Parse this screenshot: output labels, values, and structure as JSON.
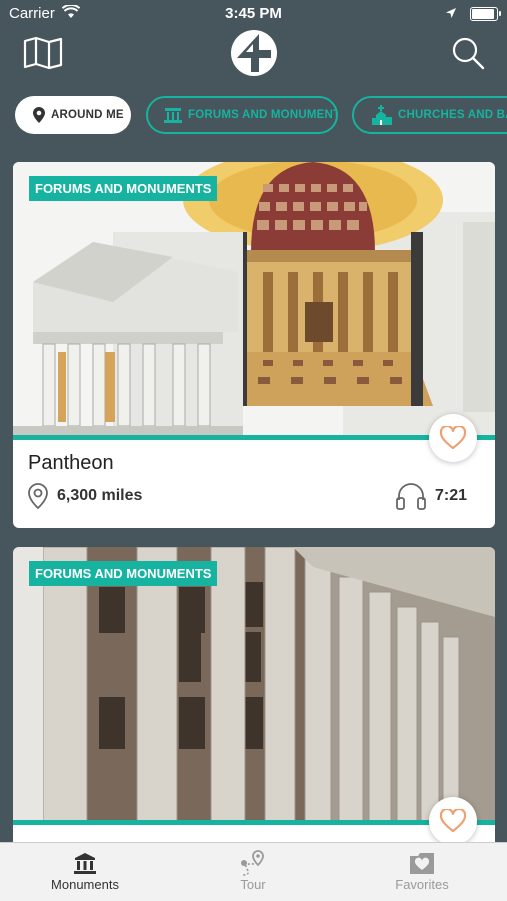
{
  "status_bar": {
    "carrier": "Carrier",
    "time": "3:45 PM",
    "battery_level": 1.0
  },
  "navbar": {
    "left_icon": "map-icon",
    "logo": "app-logo",
    "right_icon": "search-icon"
  },
  "filters": [
    {
      "label": "AROUND ME",
      "icon": "location-pin-icon",
      "active": true
    },
    {
      "label": "FORUMS AND MONUMENTS",
      "icon": "monument-icon",
      "active": false
    },
    {
      "label": "CHURCHES AND BASILIC",
      "icon": "church-icon",
      "active": false
    }
  ],
  "cards": [
    {
      "category": "FORUMS AND MONUMENTS",
      "title": "Pantheon",
      "distance": "6,300 miles",
      "duration": "7:21",
      "favorite": false
    },
    {
      "category": "FORUMS AND MONUMENTS",
      "favorite": false
    }
  ],
  "tabs": [
    {
      "label": "Monuments",
      "icon": "monument-icon",
      "active": true
    },
    {
      "label": "Tour",
      "icon": "route-icon",
      "active": false
    },
    {
      "label": "Favorites",
      "icon": "favorites-folder-icon",
      "active": false
    }
  ],
  "colors": {
    "background": "#47555c",
    "accent": "#16b3a0",
    "heart": "#f0a070"
  }
}
